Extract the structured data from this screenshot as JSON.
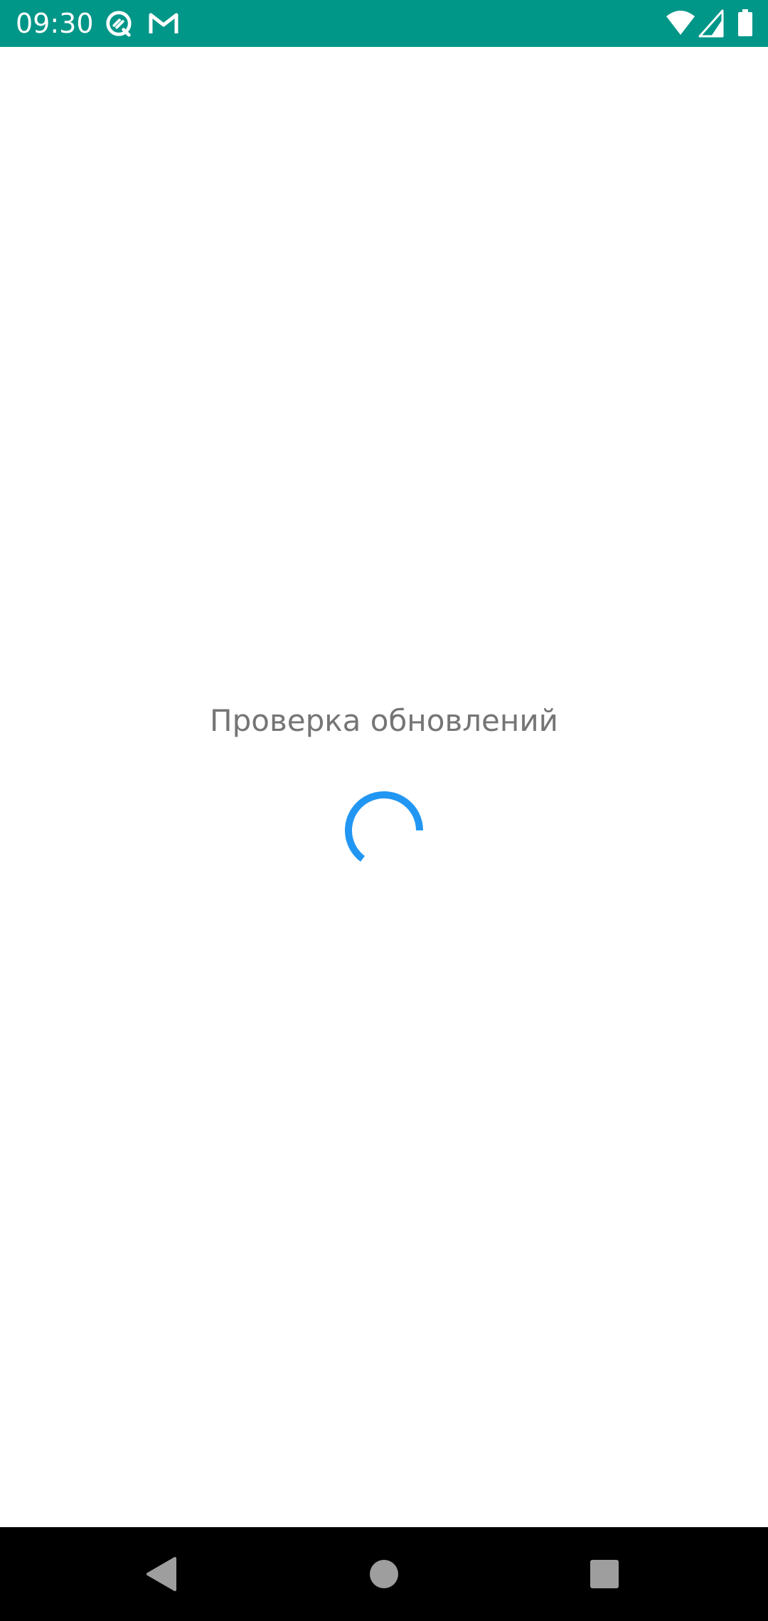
{
  "status_bar": {
    "time": "09:30",
    "background_color": "#009688",
    "left_icons": [
      "proxy-app-icon",
      "gmail-icon"
    ],
    "right_icons": [
      "wifi-icon",
      "cell-signal-icon",
      "battery-icon"
    ]
  },
  "main": {
    "loading_text": "Проверка обновлений",
    "spinner_color": "#2196F3",
    "text_color": "#757575"
  },
  "nav_bar": {
    "buttons": [
      "back-icon",
      "home-icon",
      "recents-icon"
    ],
    "icon_color": "#9E9E9E"
  }
}
